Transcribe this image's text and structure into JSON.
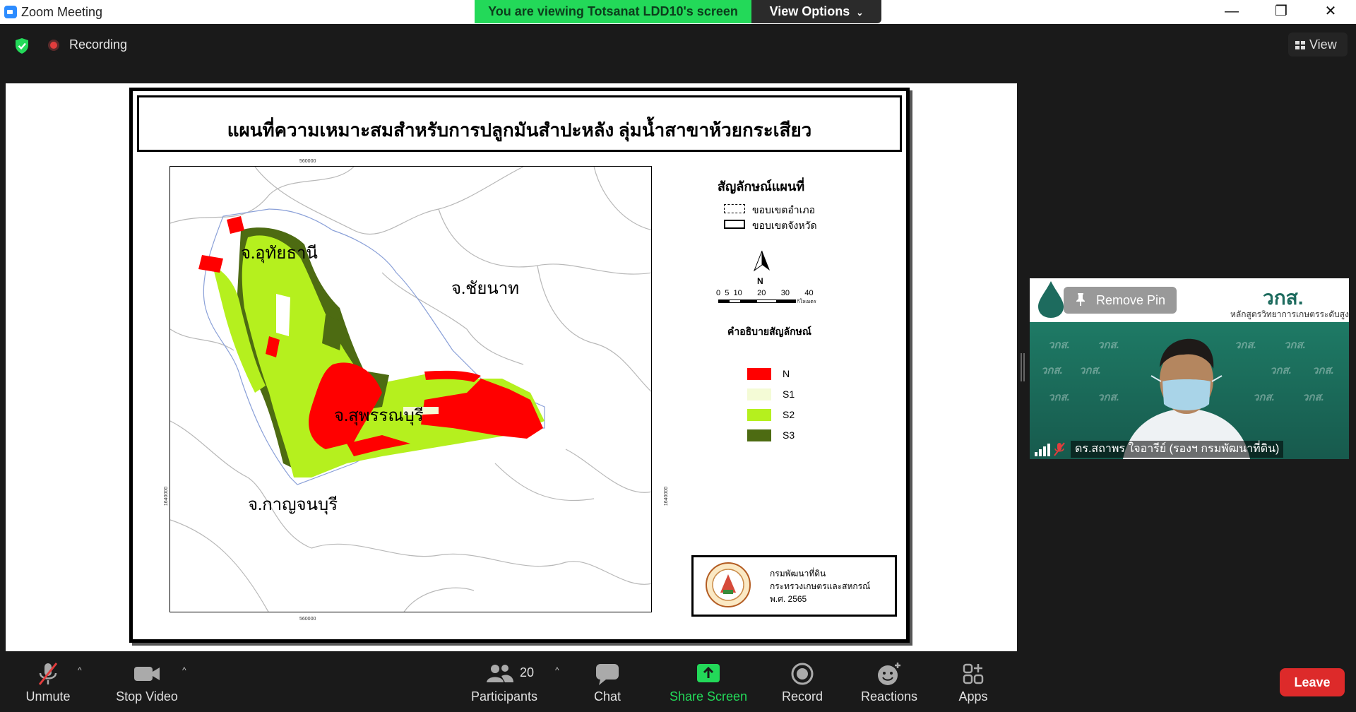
{
  "window": {
    "title": "Zoom Meeting"
  },
  "share_banner": {
    "text": "You are viewing Totsanat LDD10's screen",
    "view_options": "View Options"
  },
  "window_controls": {
    "minimize": "—",
    "restore": "❐",
    "close": "✕"
  },
  "topbar": {
    "recording_label": "Recording",
    "view_label": "View"
  },
  "map": {
    "title": "แผนที่ความเหมาะสมสำหรับการปลูกมันสำปะหลัง ลุ่มน้ำสาขาห้วยกระเสียว",
    "legend_title": "สัญลักษณ์แผนที่",
    "boundary_district": "ขอบเขตอำเภอ",
    "boundary_province": "ขอบเขตจังหวัด",
    "north": "N",
    "scale_numbers": "0  5  10       20       30       40",
    "scale_unit": "กิโลเมตร",
    "class_title": "คำอธิบายสัญลักษณ์",
    "classes": [
      {
        "label": "N",
        "color": "#ff0000"
      },
      {
        "label": "S1",
        "color": "#f4fbd6"
      },
      {
        "label": "S2",
        "color": "#b5f01e"
      },
      {
        "label": "S3",
        "color": "#4d6b12"
      }
    ],
    "provinces": {
      "uthai": "จ.อุทัยธานี",
      "chainat": "จ.ชัยนาท",
      "suphan": "จ.สุพรรณบุรี",
      "kanchanaburi": "จ.กาญจนบุรี"
    },
    "ticks": {
      "top": "560000",
      "bottom": "560000",
      "left": "1640000",
      "right": "1640000"
    },
    "agency": {
      "line1": "กรมพัฒนาที่ดิน",
      "line2": "กระทรวงเกษตรและสหกรณ์",
      "line3": "พ.ศ. 2565"
    }
  },
  "video": {
    "remove_pin": "Remove Pin",
    "brand": "วกส.",
    "brand_sub": "หลักสูตรวิทยาการเกษตรระดับสูง",
    "watermark": "วกส.",
    "participant_name": "ดร.สถาพร ใจอารีย์ (รองฯ กรมพัฒนาที่ดิน)"
  },
  "toolbar": {
    "unmute": "Unmute",
    "stop_video": "Stop Video",
    "participants": "Participants",
    "participants_count": "20",
    "chat": "Chat",
    "share_screen": "Share Screen",
    "record": "Record",
    "reactions": "Reactions",
    "apps": "Apps",
    "leave": "Leave"
  },
  "colors": {
    "share_green": "#23d959",
    "leave_red": "#dd2a2a",
    "bg": "#1a1a1a"
  }
}
